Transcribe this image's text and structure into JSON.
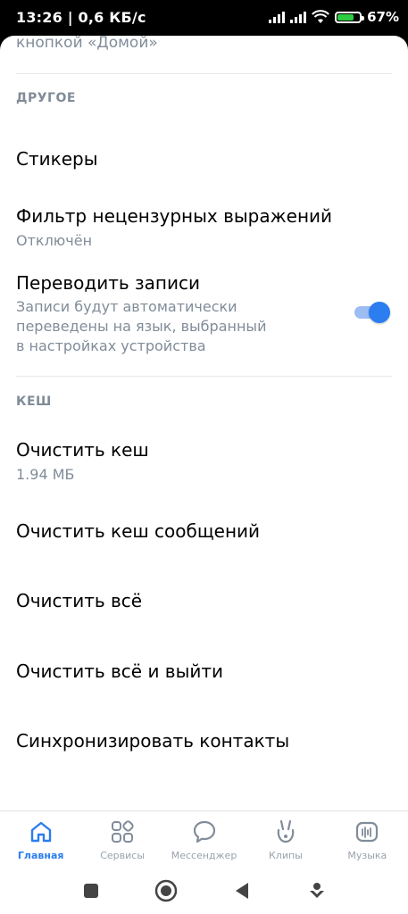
{
  "status": {
    "time": "13:26 | 0,6 КБ/с",
    "battery": "67%",
    "battery_fill": 0.67
  },
  "settings": {
    "partial_top_text": "кнопкой «Домой»",
    "section_other": "ДРУГОЕ",
    "stickers": "Стикеры",
    "filter_title": "Фильтр нецензурных выражений",
    "filter_value": "Отключён",
    "translate_title": "Переводить записи",
    "translate_desc_1": "Записи будут автоматически",
    "translate_desc_2": "переведены на язык, выбранный",
    "translate_desc_3": "в настройках устройства",
    "translate_enabled": true,
    "section_cache": "КЕШ",
    "clear_cache_title": "Очистить кеш",
    "clear_cache_size": "1.94 МБ",
    "clear_messages_cache": "Очистить кеш сообщений",
    "clear_all": "Очистить всё",
    "clear_all_logout": "Очистить всё и выйти",
    "sync_contacts": "Синхронизировать контакты"
  },
  "tabs": [
    {
      "label": "Главная",
      "icon": "home-icon",
      "active": true
    },
    {
      "label": "Сервисы",
      "icon": "services-icon",
      "active": false
    },
    {
      "label": "Мессенджер",
      "icon": "messenger-icon",
      "active": false
    },
    {
      "label": "Клипы",
      "icon": "clips-icon",
      "active": false
    },
    {
      "label": "Музыка",
      "icon": "music-icon",
      "active": false
    }
  ],
  "colors": {
    "accent": "#2b7df0",
    "secondary_text": "#818c99"
  }
}
